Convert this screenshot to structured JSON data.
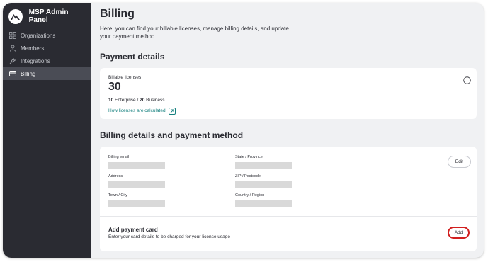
{
  "sidebar": {
    "app_name": "MSP Admin Panel",
    "items": [
      {
        "label": "Organizations",
        "icon": "grid-icon"
      },
      {
        "label": "Members",
        "icon": "user-icon"
      },
      {
        "label": "Integrations",
        "icon": "plug-icon"
      },
      {
        "label": "Billing",
        "icon": "card-icon",
        "active": true
      }
    ]
  },
  "page": {
    "title": "Billing",
    "description": "Here, you can find your billable licenses, manage billing details, and update your payment method"
  },
  "payment_details": {
    "section_title": "Payment details",
    "licenses_label": "Billable licenses",
    "licenses_count": "30",
    "enterprise_count": "10",
    "enterprise_label": "Enterprise /",
    "business_count": "20",
    "business_label": "Business",
    "link_text": "How licenses are calculated"
  },
  "billing": {
    "section_title": "Billing details and payment method",
    "fields": {
      "billing_email": "Billing email",
      "state": "State / Province",
      "address": "Address",
      "zip": "ZIP / Postcode",
      "town": "Town / City",
      "country": "Country / Region"
    },
    "edit_label": "Edit",
    "add_title": "Add payment card",
    "add_subtitle": "Enter your card details to be charged for your license usage",
    "add_label": "Add"
  },
  "colors": {
    "sidebar_bg": "#2a2b32",
    "active_item": "#4a4c55",
    "link": "#16807f",
    "highlight": "#d21f1f"
  }
}
